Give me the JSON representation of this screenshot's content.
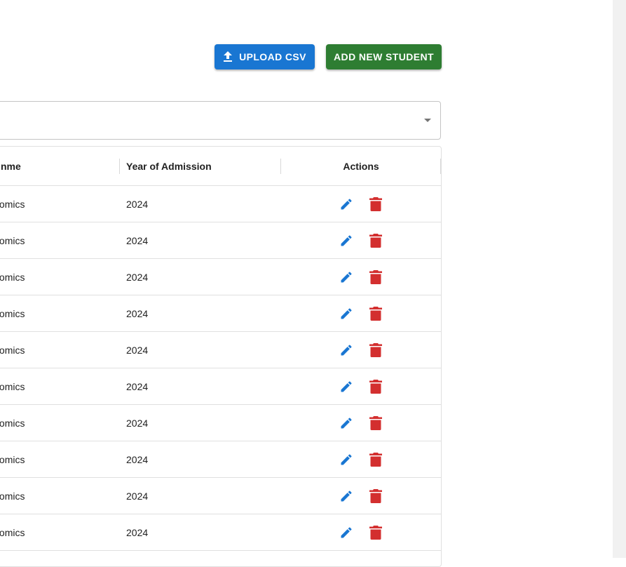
{
  "toolbar": {
    "upload_label": "UPLOAD CSV",
    "upload_icon": "upload-icon",
    "add_label": "ADD NEW STUDENT"
  },
  "filter": {
    "selected_value": "",
    "arrow_icon": "dropdown-arrow-icon"
  },
  "table": {
    "columns": {
      "programme": "nme",
      "year": "Year of Admission",
      "actions": "Actions"
    },
    "action_icons": {
      "edit": "edit-pencil-icon",
      "delete": "delete-trash-icon"
    },
    "rows": [
      {
        "programme": "Economics",
        "year": "2024"
      },
      {
        "programme": "Economics",
        "year": "2024"
      },
      {
        "programme": "Economics",
        "year": "2024"
      },
      {
        "programme": "Economics",
        "year": "2024"
      },
      {
        "programme": "Economics",
        "year": "2024"
      },
      {
        "programme": "Economics",
        "year": "2024"
      },
      {
        "programme": "Economics",
        "year": "2024"
      },
      {
        "programme": "Economics",
        "year": "2024"
      },
      {
        "programme": "Economics",
        "year": "2024"
      },
      {
        "programme": "Economics",
        "year": "2024"
      }
    ]
  },
  "colors": {
    "upload_button": "#1976d2",
    "add_button": "#2e7d32",
    "edit_icon": "#1976d2",
    "delete_icon": "#d32f2f"
  }
}
